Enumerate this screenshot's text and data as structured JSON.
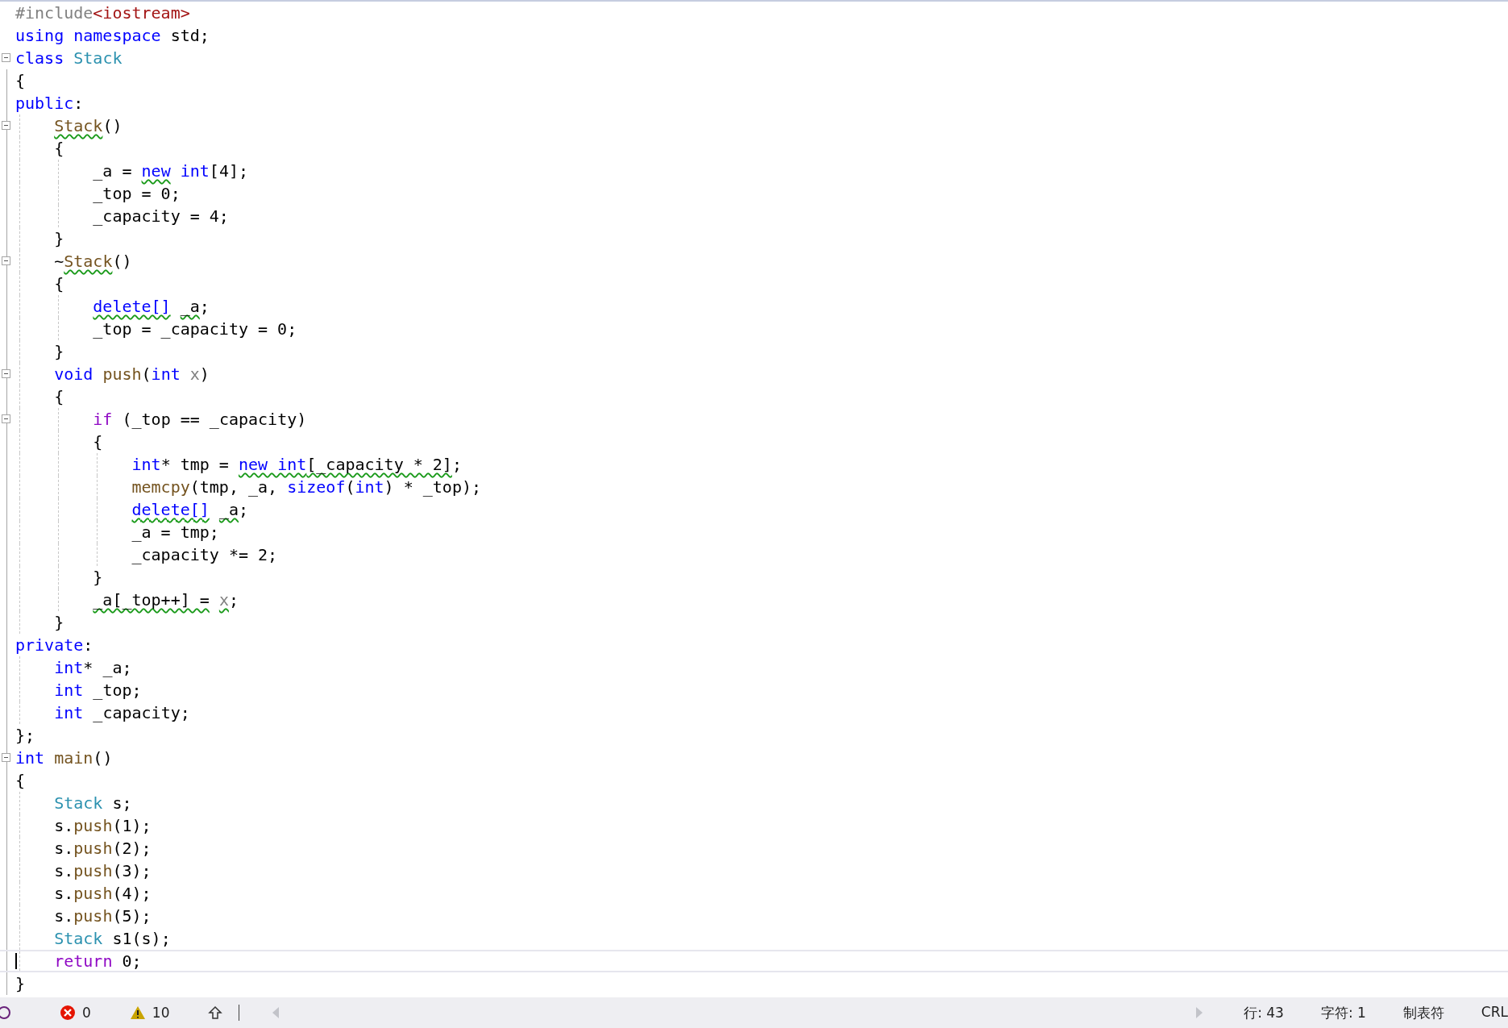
{
  "editor": {
    "lines": [
      {
        "fold": false,
        "current": false,
        "tokens": [
          {
            "kind": "preproc",
            "t": "#include",
            "squiggle": false
          },
          {
            "kind": "string",
            "t": "<iostream>",
            "squiggle": false
          }
        ]
      },
      {
        "fold": false,
        "current": false,
        "tokens": [
          {
            "kind": "keyword",
            "t": "using namespace",
            "squiggle": false
          },
          {
            "kind": "text",
            "t": " std;",
            "squiggle": false
          }
        ]
      },
      {
        "fold": true,
        "current": false,
        "tokens": [
          {
            "kind": "keyword",
            "t": "class",
            "squiggle": false
          },
          {
            "kind": "type",
            "t": " Stack",
            "squiggle": false
          }
        ]
      },
      {
        "fold": false,
        "current": false,
        "tokens": [
          {
            "kind": "text",
            "t": "{",
            "squiggle": false
          }
        ]
      },
      {
        "fold": false,
        "current": false,
        "tokens": [
          {
            "kind": "keyword",
            "t": "public",
            "squiggle": false
          },
          {
            "kind": "text",
            "t": ":",
            "squiggle": false
          }
        ]
      },
      {
        "fold": true,
        "current": false,
        "tokens": [
          {
            "kind": "func",
            "t": "    Stack",
            "squiggle": true
          },
          {
            "kind": "text",
            "t": "()",
            "squiggle": false
          }
        ]
      },
      {
        "fold": false,
        "current": false,
        "tokens": [
          {
            "kind": "text",
            "t": "    {",
            "squiggle": false
          }
        ]
      },
      {
        "fold": false,
        "current": false,
        "tokens": [
          {
            "kind": "text",
            "t": "        _a =",
            "squiggle": false
          },
          {
            "kind": "keyword",
            "t": " new",
            "squiggle": true
          },
          {
            "kind": "keyword",
            "t": " int",
            "squiggle": false
          },
          {
            "kind": "text",
            "t": "[4];",
            "squiggle": false
          }
        ]
      },
      {
        "fold": false,
        "current": false,
        "tokens": [
          {
            "kind": "text",
            "t": "        _top = 0;",
            "squiggle": false
          }
        ]
      },
      {
        "fold": false,
        "current": false,
        "tokens": [
          {
            "kind": "text",
            "t": "        _capacity = 4;",
            "squiggle": false
          }
        ]
      },
      {
        "fold": false,
        "current": false,
        "tokens": [
          {
            "kind": "text",
            "t": "    }",
            "squiggle": false
          }
        ]
      },
      {
        "fold": true,
        "current": false,
        "tokens": [
          {
            "kind": "text",
            "t": "    ~",
            "squiggle": false
          },
          {
            "kind": "func",
            "t": "Stack",
            "squiggle": true
          },
          {
            "kind": "text",
            "t": "()",
            "squiggle": false
          }
        ]
      },
      {
        "fold": false,
        "current": false,
        "tokens": [
          {
            "kind": "text",
            "t": "    {",
            "squiggle": false
          }
        ]
      },
      {
        "fold": false,
        "current": false,
        "tokens": [
          {
            "kind": "keyword",
            "t": "        delete[]",
            "squiggle": true
          },
          {
            "kind": "text",
            "t": " _a",
            "squiggle": true
          },
          {
            "kind": "text",
            "t": ";",
            "squiggle": false
          }
        ]
      },
      {
        "fold": false,
        "current": false,
        "tokens": [
          {
            "kind": "text",
            "t": "        _top = _capacity = 0;",
            "squiggle": false
          }
        ]
      },
      {
        "fold": false,
        "current": false,
        "tokens": [
          {
            "kind": "text",
            "t": "    }",
            "squiggle": false
          }
        ]
      },
      {
        "fold": true,
        "current": false,
        "tokens": [
          {
            "kind": "keyword",
            "t": "    void",
            "squiggle": false
          },
          {
            "kind": "func",
            "t": " push",
            "squiggle": false
          },
          {
            "kind": "text",
            "t": "(",
            "squiggle": false
          },
          {
            "kind": "keyword",
            "t": "int",
            "squiggle": false
          },
          {
            "kind": "param",
            "t": " x",
            "squiggle": false
          },
          {
            "kind": "text",
            "t": ")",
            "squiggle": false
          }
        ]
      },
      {
        "fold": false,
        "current": false,
        "tokens": [
          {
            "kind": "text",
            "t": "    {",
            "squiggle": false
          }
        ]
      },
      {
        "fold": true,
        "current": false,
        "tokens": [
          {
            "kind": "control",
            "t": "        if",
            "squiggle": false
          },
          {
            "kind": "text",
            "t": " (_top == _capacity)",
            "squiggle": false
          }
        ]
      },
      {
        "fold": false,
        "current": false,
        "tokens": [
          {
            "kind": "text",
            "t": "        {",
            "squiggle": false
          }
        ]
      },
      {
        "fold": false,
        "current": false,
        "tokens": [
          {
            "kind": "keyword",
            "t": "            int",
            "squiggle": false
          },
          {
            "kind": "text",
            "t": "* tmp =",
            "squiggle": false
          },
          {
            "kind": "keyword",
            "t": " new int",
            "squiggle": true
          },
          {
            "kind": "text",
            "t": "[_capacity * 2]",
            "squiggle": true
          },
          {
            "kind": "text",
            "t": ";",
            "squiggle": false
          }
        ]
      },
      {
        "fold": false,
        "current": false,
        "tokens": [
          {
            "kind": "func",
            "t": "            memcpy",
            "squiggle": false
          },
          {
            "kind": "text",
            "t": "(tmp, _a,",
            "squiggle": false
          },
          {
            "kind": "keyword",
            "t": " sizeof",
            "squiggle": false
          },
          {
            "kind": "text",
            "t": "(",
            "squiggle": false
          },
          {
            "kind": "keyword",
            "t": "int",
            "squiggle": false
          },
          {
            "kind": "text",
            "t": ") * _top);",
            "squiggle": false
          }
        ]
      },
      {
        "fold": false,
        "current": false,
        "tokens": [
          {
            "kind": "keyword",
            "t": "            delete[]",
            "squiggle": true
          },
          {
            "kind": "text",
            "t": " _a",
            "squiggle": true
          },
          {
            "kind": "text",
            "t": ";",
            "squiggle": false
          }
        ]
      },
      {
        "fold": false,
        "current": false,
        "tokens": [
          {
            "kind": "text",
            "t": "            _a = tmp;",
            "squiggle": false
          }
        ]
      },
      {
        "fold": false,
        "current": false,
        "tokens": [
          {
            "kind": "text",
            "t": "            _capacity *= 2;",
            "squiggle": false
          }
        ]
      },
      {
        "fold": false,
        "current": false,
        "tokens": [
          {
            "kind": "text",
            "t": "        }",
            "squiggle": false
          }
        ]
      },
      {
        "fold": false,
        "current": false,
        "tokens": [
          {
            "kind": "text",
            "t": "        _a[_top++] =",
            "squiggle": true
          },
          {
            "kind": "param",
            "t": " x",
            "squiggle": true
          },
          {
            "kind": "text",
            "t": ";",
            "squiggle": false
          }
        ]
      },
      {
        "fold": false,
        "current": false,
        "tokens": [
          {
            "kind": "text",
            "t": "    }",
            "squiggle": false
          }
        ]
      },
      {
        "fold": false,
        "current": false,
        "tokens": [
          {
            "kind": "keyword",
            "t": "private",
            "squiggle": false
          },
          {
            "kind": "text",
            "t": ":",
            "squiggle": false
          }
        ]
      },
      {
        "fold": false,
        "current": false,
        "tokens": [
          {
            "kind": "keyword",
            "t": "    int",
            "squiggle": false
          },
          {
            "kind": "text",
            "t": "* _a;",
            "squiggle": false
          }
        ]
      },
      {
        "fold": false,
        "current": false,
        "tokens": [
          {
            "kind": "keyword",
            "t": "    int",
            "squiggle": false
          },
          {
            "kind": "text",
            "t": " _top;",
            "squiggle": false
          }
        ]
      },
      {
        "fold": false,
        "current": false,
        "tokens": [
          {
            "kind": "keyword",
            "t": "    int",
            "squiggle": false
          },
          {
            "kind": "text",
            "t": " _capacity;",
            "squiggle": false
          }
        ]
      },
      {
        "fold": false,
        "current": false,
        "tokens": [
          {
            "kind": "text",
            "t": "};",
            "squiggle": false
          }
        ]
      },
      {
        "fold": true,
        "current": false,
        "tokens": [
          {
            "kind": "keyword",
            "t": "int",
            "squiggle": false
          },
          {
            "kind": "func",
            "t": " main",
            "squiggle": false
          },
          {
            "kind": "text",
            "t": "()",
            "squiggle": false
          }
        ]
      },
      {
        "fold": false,
        "current": false,
        "tokens": [
          {
            "kind": "text",
            "t": "{",
            "squiggle": false
          }
        ]
      },
      {
        "fold": false,
        "current": false,
        "tokens": [
          {
            "kind": "type",
            "t": "    Stack",
            "squiggle": false
          },
          {
            "kind": "text",
            "t": " s;",
            "squiggle": false
          }
        ]
      },
      {
        "fold": false,
        "current": false,
        "tokens": [
          {
            "kind": "text",
            "t": "    s.",
            "squiggle": false
          },
          {
            "kind": "func",
            "t": "push",
            "squiggle": false
          },
          {
            "kind": "text",
            "t": "(1);",
            "squiggle": false
          }
        ]
      },
      {
        "fold": false,
        "current": false,
        "tokens": [
          {
            "kind": "text",
            "t": "    s.",
            "squiggle": false
          },
          {
            "kind": "func",
            "t": "push",
            "squiggle": false
          },
          {
            "kind": "text",
            "t": "(2);",
            "squiggle": false
          }
        ]
      },
      {
        "fold": false,
        "current": false,
        "tokens": [
          {
            "kind": "text",
            "t": "    s.",
            "squiggle": false
          },
          {
            "kind": "func",
            "t": "push",
            "squiggle": false
          },
          {
            "kind": "text",
            "t": "(3);",
            "squiggle": false
          }
        ]
      },
      {
        "fold": false,
        "current": false,
        "tokens": [
          {
            "kind": "text",
            "t": "    s.",
            "squiggle": false
          },
          {
            "kind": "func",
            "t": "push",
            "squiggle": false
          },
          {
            "kind": "text",
            "t": "(4);",
            "squiggle": false
          }
        ]
      },
      {
        "fold": false,
        "current": false,
        "tokens": [
          {
            "kind": "text",
            "t": "    s.",
            "squiggle": false
          },
          {
            "kind": "func",
            "t": "push",
            "squiggle": false
          },
          {
            "kind": "text",
            "t": "(5);",
            "squiggle": false
          }
        ]
      },
      {
        "fold": false,
        "current": false,
        "tokens": [
          {
            "kind": "type",
            "t": "    Stack",
            "squiggle": false
          },
          {
            "kind": "text",
            "t": " s1(s);",
            "squiggle": false
          }
        ]
      },
      {
        "fold": false,
        "current": true,
        "tokens": [
          {
            "kind": "control",
            "t": "    return",
            "squiggle": false
          },
          {
            "kind": "text",
            "t": " 0;",
            "squiggle": false
          }
        ]
      },
      {
        "fold": false,
        "current": false,
        "tokens": [
          {
            "kind": "text",
            "t": "}",
            "squiggle": false
          }
        ]
      }
    ]
  },
  "status_bar": {
    "issues": [
      {
        "kind": "errors",
        "count": "0"
      },
      {
        "kind": "warnings",
        "count": "10"
      }
    ],
    "position": [
      {
        "text": "行: 43"
      },
      {
        "text": "字符: 1"
      },
      {
        "text": "制表符"
      },
      {
        "text": "CRL"
      }
    ]
  }
}
